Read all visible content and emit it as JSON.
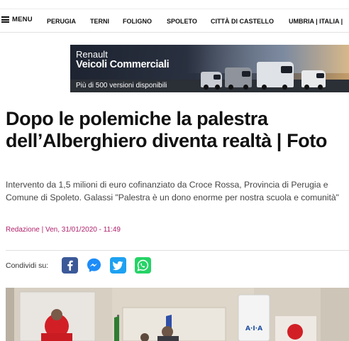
{
  "nav": {
    "menu_label": "MENU",
    "items": [
      "PERUGIA",
      "TERNI",
      "FOLIGNO",
      "SPOLETO",
      "CITTÀ DI CASTELLO",
      "UMBRIA | ITALIA |"
    ]
  },
  "ad": {
    "brand": "Renault",
    "title": "Veicoli Commerciali",
    "subtitle": "Più di 500 versioni disponibili"
  },
  "article": {
    "headline": "Dopo le polemiche la palestra dell’Alberghiero diventa realtà | Foto",
    "summary": "Intervento da 1,5 milioni di euro cofinanziato da Croce Rossa, Provincia di Perugia e Comune di Spoleto. Galassi \"Palestra è un dono enorme per nostra scuola e comunità\"",
    "byline": "Redazione | Ven, 31/01/2020 - 11:49"
  },
  "share": {
    "label": "Condividi su:",
    "networks": [
      "facebook-icon",
      "messenger-icon",
      "twitter-icon",
      "whatsapp-icon"
    ]
  },
  "photo": {
    "sign_text": "A·I·A"
  },
  "colors": {
    "byline": "#b0226b",
    "facebook": "#3b5998",
    "messenger": "#1d8cf8",
    "twitter": "#1da1f2",
    "whatsapp": "#25d366",
    "red_cross": "#d21f26"
  }
}
